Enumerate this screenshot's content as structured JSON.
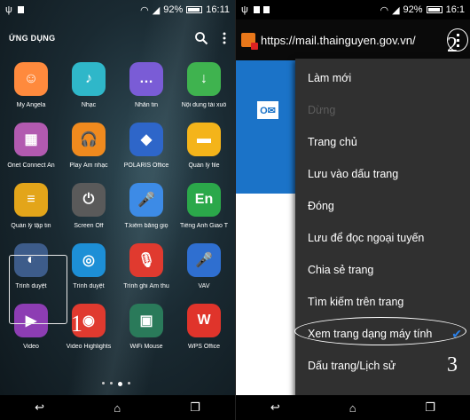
{
  "left": {
    "status": {
      "battery": "92%",
      "time": "16:11"
    },
    "header_title": "ỨNG DỤNG",
    "apps": [
      {
        "label": "My Angela",
        "color": "#ff8a3d",
        "glyph": "☺"
      },
      {
        "label": "Nhạc",
        "color": "#2fb7c9",
        "glyph": "♪"
      },
      {
        "label": "Nhắn tin",
        "color": "#7a5cd6",
        "glyph": "…"
      },
      {
        "label": "Nội dung tải xuố",
        "color": "#3fb34f",
        "glyph": "↓"
      },
      {
        "label": "Onet Connect An",
        "color": "#b25ab0",
        "glyph": "▦"
      },
      {
        "label": "Play Âm nhạc",
        "color": "#f08a1e",
        "glyph": "🎧"
      },
      {
        "label": "POLARIS Office",
        "color": "#2e66c9",
        "glyph": "◆"
      },
      {
        "label": "Quản lý file",
        "color": "#f4b41a",
        "glyph": "▬"
      },
      {
        "label": "Quản lý tập tin",
        "color": "#e3a51a",
        "glyph": "≡"
      },
      {
        "label": "Screen Off",
        "color": "#5a5a5a",
        "glyph": "⏻"
      },
      {
        "label": "T.kiếm bằng giọ",
        "color": "#3d8be6",
        "glyph": "🎤"
      },
      {
        "label": "Tiếng Anh Giao T",
        "color": "#2ba84a",
        "glyph": "En"
      },
      {
        "label": "Trình duyệt",
        "color": "#3d5c8a",
        "glyph": "◐"
      },
      {
        "label": "Trình duyệt",
        "color": "#1d8fd6",
        "glyph": "◎"
      },
      {
        "label": "Trình ghi Âm thu",
        "color": "#e03a2f",
        "glyph": "🎙"
      },
      {
        "label": "VAV",
        "color": "#2f6fd0",
        "glyph": "🎤"
      },
      {
        "label": "Video",
        "color": "#8d3db3",
        "glyph": "▶"
      },
      {
        "label": "Video Highlights",
        "color": "#e03a2f",
        "glyph": "◉"
      },
      {
        "label": "WiFi Mouse",
        "color": "#2a7a5a",
        "glyph": "▣"
      },
      {
        "label": "WPS Office",
        "color": "#e0342b",
        "glyph": "W"
      }
    ],
    "annotation_number": "1"
  },
  "right": {
    "status": {
      "battery": "92%",
      "time": "16:1"
    },
    "url": "https://mail.thainguyen.gov.vn/",
    "annotation_2": "2",
    "annotation_3": "3",
    "menu": [
      {
        "label": "Làm mới",
        "enabled": true
      },
      {
        "label": "Dừng",
        "enabled": false
      },
      {
        "label": "Trang chủ",
        "enabled": true
      },
      {
        "label": "Lưu vào dấu trang",
        "enabled": true
      },
      {
        "label": "Đóng",
        "enabled": true
      },
      {
        "label": "Lưu để đọc ngoại tuyến",
        "enabled": true
      },
      {
        "label": "Chia sẻ trang",
        "enabled": true
      },
      {
        "label": "Tìm kiếm trên trang",
        "enabled": true
      },
      {
        "label": "Xem trang dạng máy tính",
        "enabled": true,
        "checked": true
      },
      {
        "label": "Dấu trang/Lịch sử",
        "enabled": true
      }
    ]
  }
}
